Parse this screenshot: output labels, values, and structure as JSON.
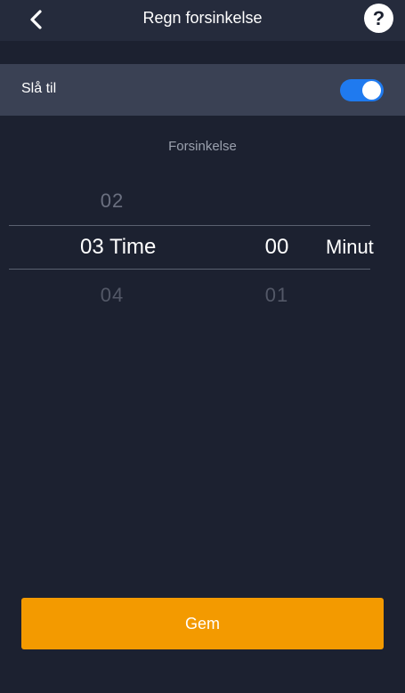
{
  "header": {
    "title": "Regn forsinkelse",
    "back_icon": "chevron-left-icon",
    "help_label": "?"
  },
  "toggle_row": {
    "label": "Slå til",
    "enabled": true,
    "accent_color": "#1f7aef"
  },
  "picker": {
    "label": "Forsinkelse",
    "hours": {
      "previous": "02",
      "selected": "03",
      "next": "04",
      "unit": "Time"
    },
    "minutes": {
      "previous": "",
      "selected": "00",
      "next": "01",
      "unit": "Minut"
    }
  },
  "save_button": {
    "label": "Gem",
    "color": "#f39a00"
  }
}
